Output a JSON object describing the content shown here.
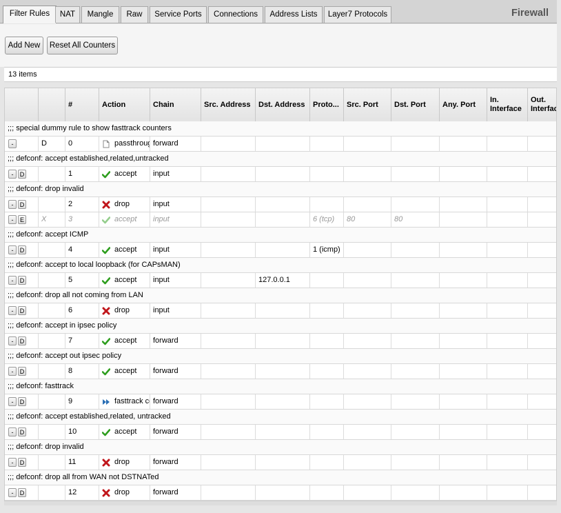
{
  "tabs": [
    {
      "label": "Filter Rules",
      "active": true
    },
    {
      "label": "NAT"
    },
    {
      "label": "Mangle"
    },
    {
      "label": "Raw"
    },
    {
      "label": "Service Ports"
    },
    {
      "label": "Connections"
    },
    {
      "label": "Address Lists"
    },
    {
      "label": "Layer7 Protocols"
    }
  ],
  "title": "Firewall",
  "toolbar": {
    "add_new": "Add New",
    "reset_counters": "Reset All Counters"
  },
  "item_count": "13 items",
  "columns": [
    "",
    "",
    "#",
    "Action",
    "Chain",
    "Src. Address",
    "Dst. Address",
    "Proto...",
    "Src. Port",
    "Dst. Port",
    "Any. Port",
    "In. Interface",
    "Out. Interface"
  ],
  "colors": {
    "accept": "#2e9e1e",
    "drop": "#c0161b",
    "fasttrack": "#2a6fb5",
    "disabled_text": "#999999"
  },
  "rows": [
    {
      "type": "comment",
      "text": ";;; special dummy rule to show fasttrack counters"
    },
    {
      "type": "rule",
      "btn1": "-",
      "flag": "D",
      "num": "0",
      "action": "passthrough",
      "icon": "document-icon",
      "chain": "forward"
    },
    {
      "type": "comment",
      "text": ";;; defconf: accept established,related,untracked"
    },
    {
      "type": "rule",
      "btn1": "-",
      "btn2": "D",
      "num": "1",
      "action": "accept",
      "icon": "check-icon",
      "chain": "input"
    },
    {
      "type": "comment",
      "text": ";;; defconf: drop invalid"
    },
    {
      "type": "rule",
      "btn1": "-",
      "btn2": "D",
      "num": "2",
      "action": "drop",
      "icon": "cross-icon",
      "chain": "input"
    },
    {
      "type": "rule",
      "disabled": true,
      "btn1": "-",
      "btn2": "E",
      "flag": "X",
      "num": "3",
      "action": "accept",
      "icon": "check-icon",
      "chain": "input",
      "proto": "6 (tcp)",
      "src_port": "80",
      "dst_port": "80"
    },
    {
      "type": "comment",
      "text": ";;; defconf: accept ICMP"
    },
    {
      "type": "rule",
      "btn1": "-",
      "btn2": "D",
      "num": "4",
      "action": "accept",
      "icon": "check-icon",
      "chain": "input",
      "proto": "1 (icmp)"
    },
    {
      "type": "comment",
      "text": ";;; defconf: accept to local loopback (for CAPsMAN)"
    },
    {
      "type": "rule",
      "btn1": "-",
      "btn2": "D",
      "num": "5",
      "action": "accept",
      "icon": "check-icon",
      "chain": "input",
      "dst": "127.0.0.1"
    },
    {
      "type": "comment",
      "text": ";;; defconf: drop all not coming from LAN"
    },
    {
      "type": "rule",
      "btn1": "-",
      "btn2": "D",
      "num": "6",
      "action": "drop",
      "icon": "cross-icon",
      "chain": "input"
    },
    {
      "type": "comment",
      "text": ";;; defconf: accept in ipsec policy"
    },
    {
      "type": "rule",
      "btn1": "-",
      "btn2": "D",
      "num": "7",
      "action": "accept",
      "icon": "check-icon",
      "chain": "forward"
    },
    {
      "type": "comment",
      "text": ";;; defconf: accept out ipsec policy"
    },
    {
      "type": "rule",
      "btn1": "-",
      "btn2": "D",
      "num": "8",
      "action": "accept",
      "icon": "check-icon",
      "chain": "forward"
    },
    {
      "type": "comment",
      "text": ";;; defconf: fasttrack"
    },
    {
      "type": "rule",
      "btn1": "-",
      "btn2": "D",
      "num": "9",
      "action": "fasttrack connection",
      "icon": "fast-forward-icon",
      "chain": "forward"
    },
    {
      "type": "comment",
      "text": ";;; defconf: accept established,related, untracked"
    },
    {
      "type": "rule",
      "btn1": "-",
      "btn2": "D",
      "num": "10",
      "action": "accept",
      "icon": "check-icon",
      "chain": "forward"
    },
    {
      "type": "comment",
      "text": ";;; defconf: drop invalid"
    },
    {
      "type": "rule",
      "btn1": "-",
      "btn2": "D",
      "num": "11",
      "action": "drop",
      "icon": "cross-icon",
      "chain": "forward"
    },
    {
      "type": "comment",
      "text": ";;; defconf: drop all from WAN not DSTNATed"
    },
    {
      "type": "rule",
      "btn1": "-",
      "btn2": "D",
      "num": "12",
      "action": "drop",
      "icon": "cross-icon",
      "chain": "forward"
    }
  ]
}
